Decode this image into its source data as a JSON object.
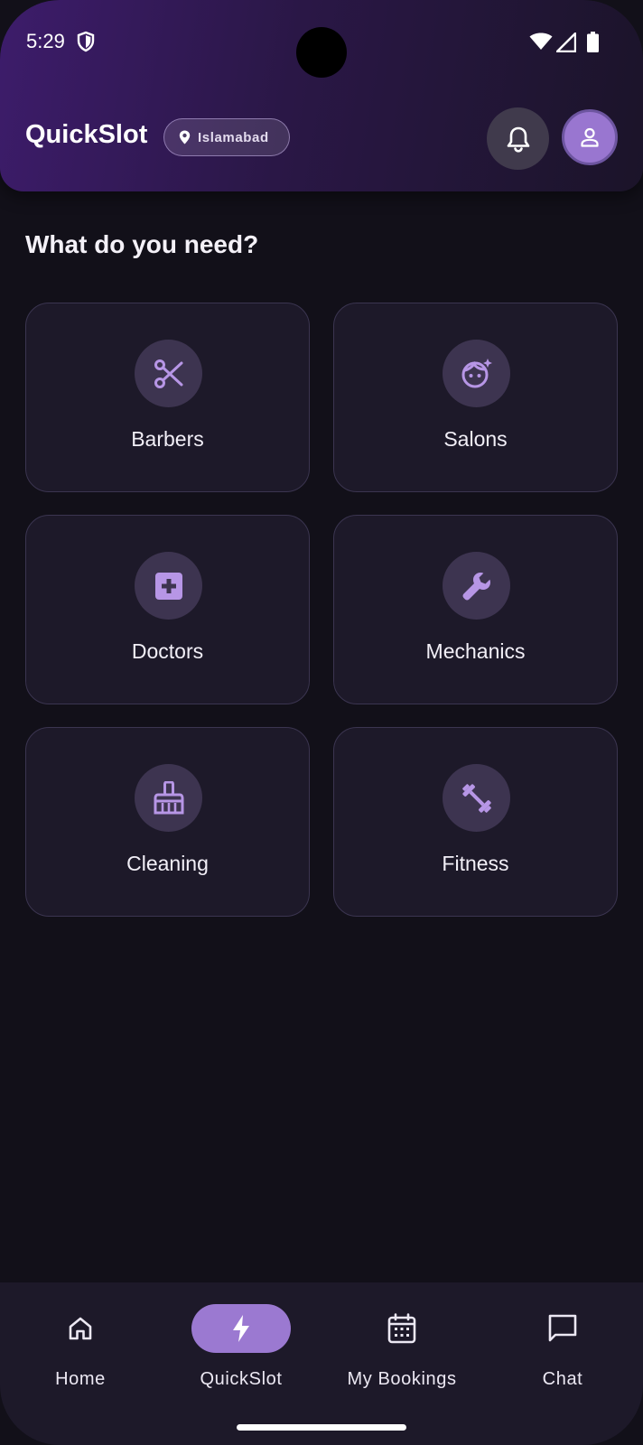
{
  "status_bar": {
    "time": "5:29"
  },
  "header": {
    "app_title": "QuickSlot",
    "location": "Islamabad",
    "icons": [
      "location-pin-icon",
      "bell-icon",
      "person-icon"
    ]
  },
  "main": {
    "section_title": "What do you need?",
    "categories": [
      {
        "label": "Barbers",
        "icon": "scissors-icon"
      },
      {
        "label": "Salons",
        "icon": "face-sparkle-icon"
      },
      {
        "label": "Doctors",
        "icon": "medical-cross-icon"
      },
      {
        "label": "Mechanics",
        "icon": "wrench-icon"
      },
      {
        "label": "Cleaning",
        "icon": "broom-icon"
      },
      {
        "label": "Fitness",
        "icon": "dumbbell-icon"
      }
    ]
  },
  "bottom_nav": {
    "items": [
      {
        "label": "Home",
        "icon": "home-icon",
        "active": false
      },
      {
        "label": "QuickSlot",
        "icon": "bolt-icon",
        "active": true
      },
      {
        "label": "My Bookings",
        "icon": "calendar-icon",
        "active": false
      },
      {
        "label": "Chat",
        "icon": "chat-bubble-icon",
        "active": false
      }
    ]
  },
  "colors": {
    "accent": "#9b79d1",
    "background": "#121019",
    "card": "#1d1929",
    "icon_tint": "#b796e6"
  }
}
